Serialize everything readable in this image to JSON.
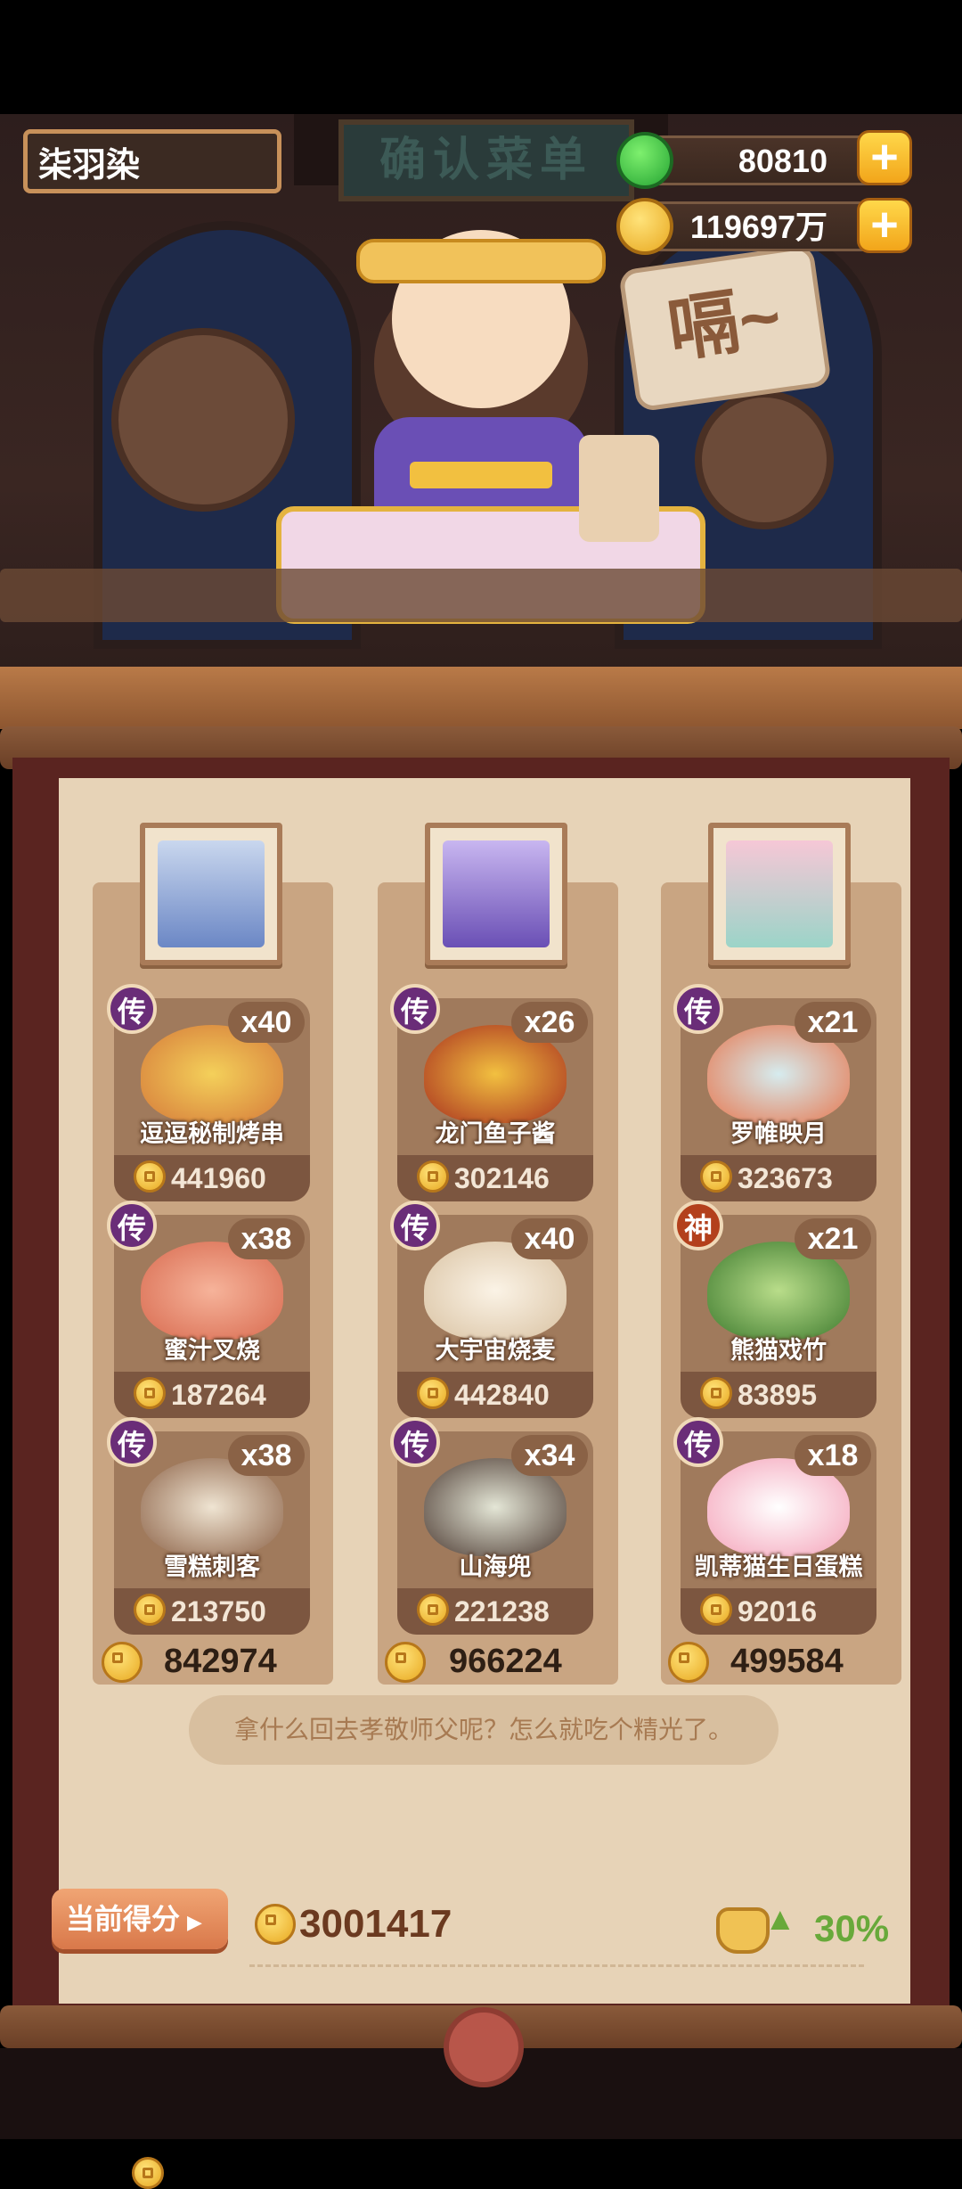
{
  "player": {
    "name": "柒羽染"
  },
  "sign_text": "确认菜单",
  "speech_bubble": "嗝~",
  "currencies": {
    "jade": "80810",
    "coins": "119697万"
  },
  "colors": {
    "accent_gold": "#f2a51a",
    "legend_purple": "#6a2d78",
    "god_red": "#b3401c",
    "score_green": "#68a93a"
  },
  "columns": [
    {
      "portrait": "silver-haired-character",
      "dishes": [
        {
          "rarity": "传",
          "count": "x40",
          "name": "逗逗秘制烤串",
          "price": "441960",
          "icon": "skewer-plate-icon"
        },
        {
          "rarity": "传",
          "count": "x38",
          "name": "蜜汁叉烧",
          "price": "187264",
          "icon": "char-siu-icon"
        },
        {
          "rarity": "传",
          "count": "x38",
          "name": "雪糕刺客",
          "price": "213750",
          "icon": "ice-cream-icon"
        }
      ],
      "total": "842974"
    },
    {
      "portrait": "purple-haired-character",
      "dishes": [
        {
          "rarity": "传",
          "count": "x26",
          "name": "龙门鱼子酱",
          "price": "302146",
          "icon": "caviar-box-icon"
        },
        {
          "rarity": "传",
          "count": "x40",
          "name": "大宇宙烧麦",
          "price": "442840",
          "icon": "dumpling-icon"
        },
        {
          "rarity": "传",
          "count": "x34",
          "name": "山海兜",
          "price": "221238",
          "icon": "pot-icon"
        }
      ],
      "total": "966224"
    },
    {
      "portrait": "pink-haired-character",
      "dishes": [
        {
          "rarity": "传",
          "count": "x21",
          "name": "罗帷映月",
          "price": "323673",
          "icon": "seafood-platter-icon"
        },
        {
          "rarity": "神",
          "count": "x21",
          "name": "熊猫戏竹",
          "price": "83895",
          "icon": "panda-bamboo-icon"
        },
        {
          "rarity": "传",
          "count": "x18",
          "name": "凯蒂猫生日蛋糕",
          "price": "92016",
          "icon": "birthday-cake-icon"
        }
      ],
      "total": "499584"
    }
  ],
  "dialogue": "拿什么回去孝敬师父呢？怎么就吃个精光了。",
  "score": {
    "label": "当前得分",
    "value": "3001417",
    "percent": "30%"
  }
}
